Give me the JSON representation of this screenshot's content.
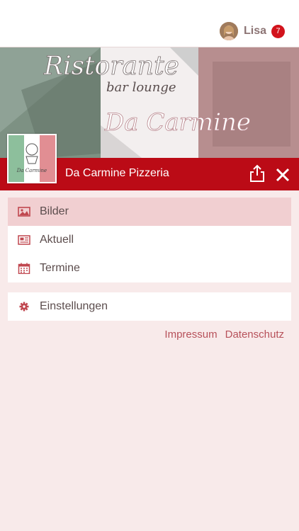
{
  "header": {
    "username": "Lisa",
    "notification_count": "7"
  },
  "hero": {
    "line1": "Ristorante",
    "line2": "bar lounge",
    "line3": "Da Carmine",
    "logo_text": "Da Carmine"
  },
  "titlebar": {
    "title": "Da Carmine Pizzeria"
  },
  "menu": {
    "main_items": [
      {
        "label": "Bilder",
        "icon": "image-icon"
      },
      {
        "label": "Aktuell",
        "icon": "newspaper-icon"
      },
      {
        "label": "Termine",
        "icon": "calendar-icon"
      }
    ],
    "settings": {
      "label": "Einstellungen",
      "icon": "gear-icon"
    }
  },
  "footer_links": {
    "impressum": "Impressum",
    "datenschutz": "Datenschutz"
  },
  "colors": {
    "accent_red": "#bb0b16",
    "background": "#f8eaea",
    "active_row": "#f1cfd1",
    "icon_red": "#c0474f",
    "badge_red": "#d2131c"
  }
}
